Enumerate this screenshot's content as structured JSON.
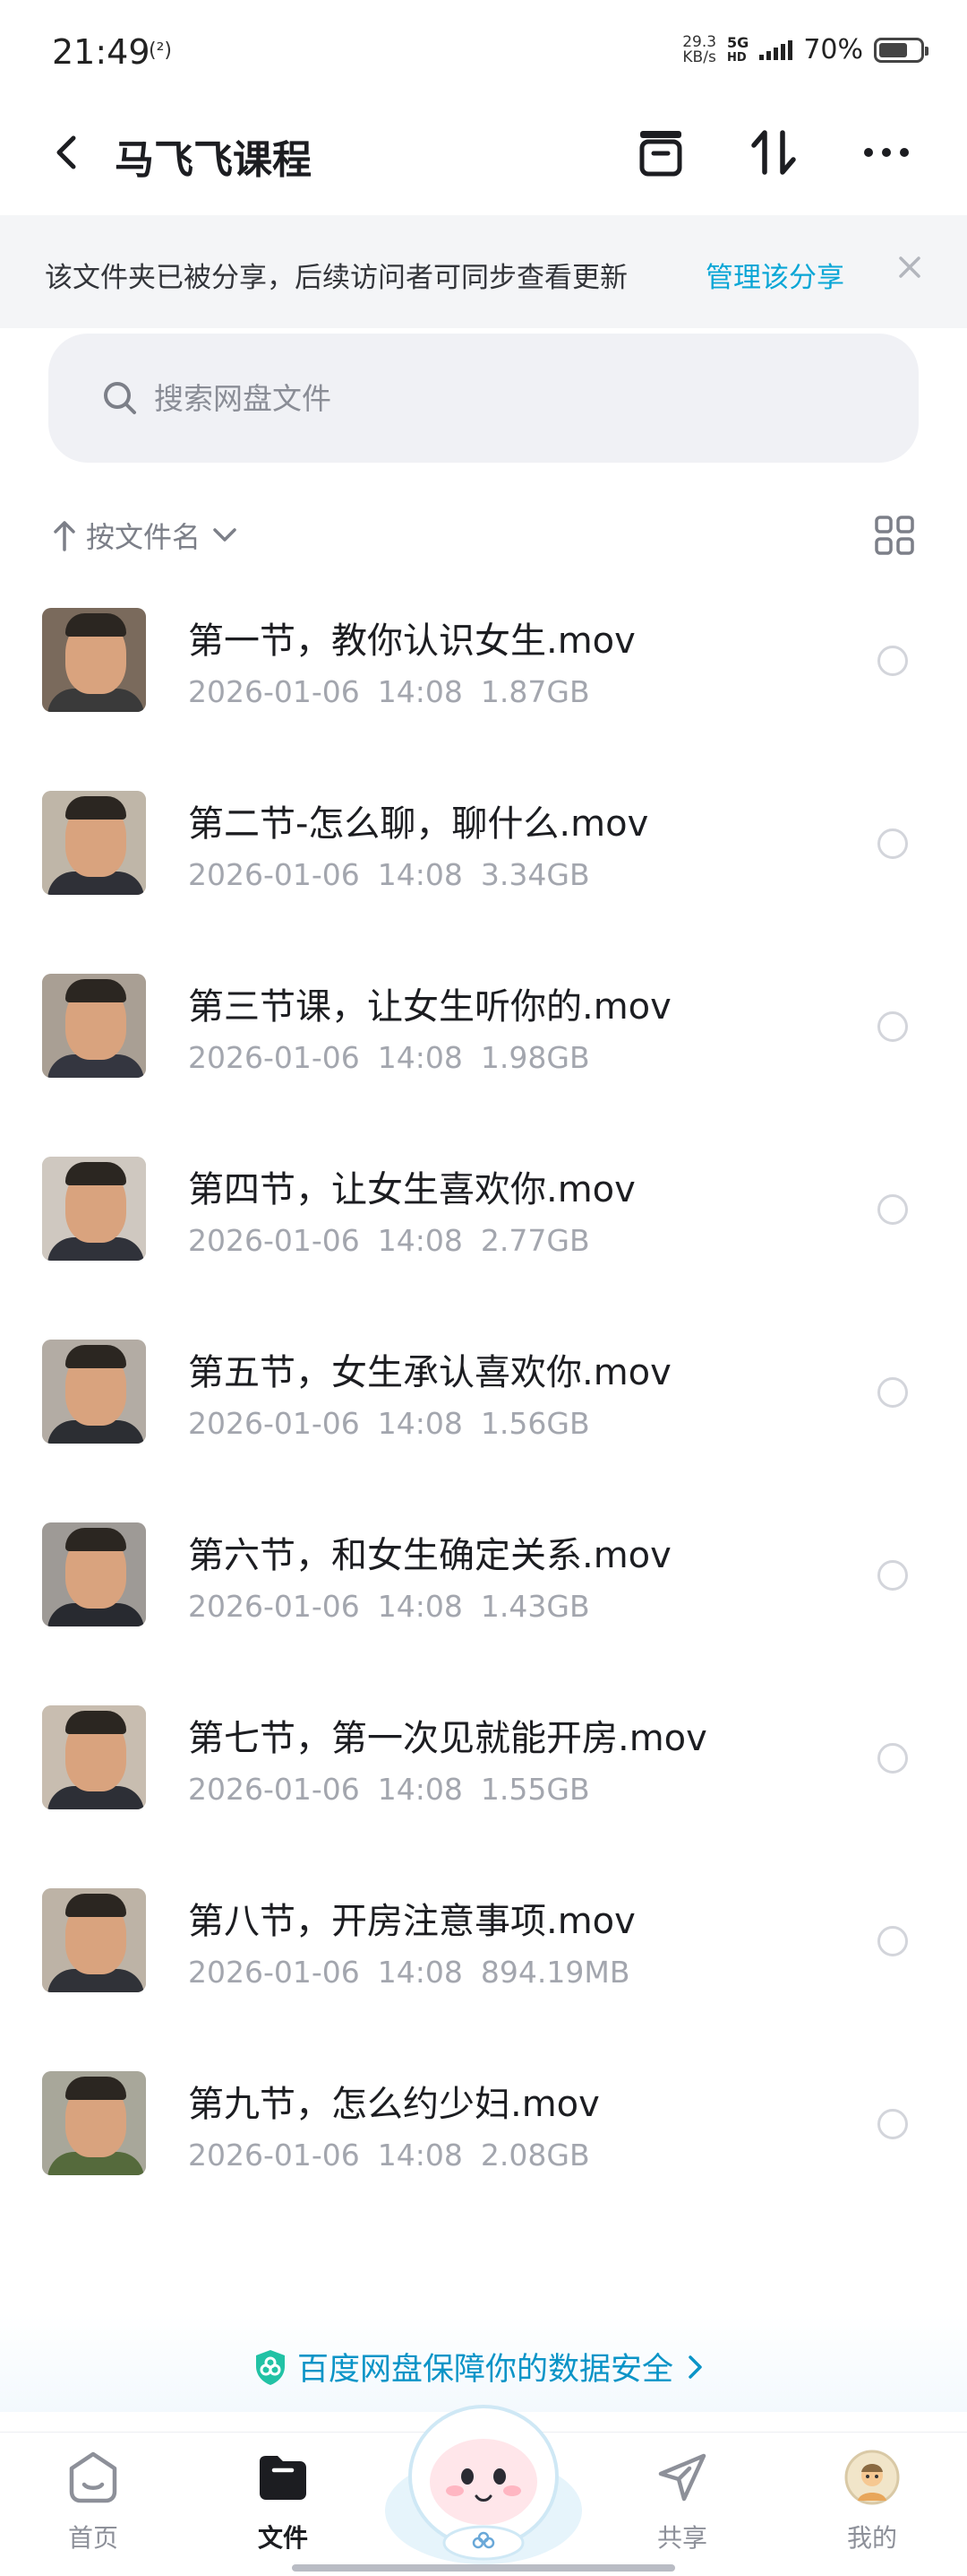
{
  "status_bar": {
    "time": "21:49",
    "signal_symbol": "(²)",
    "net_speed_value": "29.3",
    "net_speed_unit": "KB/s",
    "network_primary": "5G",
    "network_secondary": "HD",
    "battery_percent": "70%",
    "battery_level": 0.7
  },
  "header": {
    "title": "马飞飞课程",
    "icons": [
      "back-arrow-icon",
      "archive-box-icon",
      "sort-arrows-icon",
      "more-dots-icon"
    ]
  },
  "share_banner": {
    "message": "该文件夹已被分享，后续访问者可同步查看更新",
    "action": "管理该分享"
  },
  "search": {
    "placeholder": "搜索网盘文件"
  },
  "sort": {
    "label": "按文件名"
  },
  "files": [
    {
      "name": "第一节，教你认识女生.mov",
      "date": "2026-01-06",
      "time": "14:08",
      "size": "1.87GB"
    },
    {
      "name": "第二节-怎么聊，聊什么.mov",
      "date": "2026-01-06",
      "time": "14:08",
      "size": "3.34GB"
    },
    {
      "name": "第三节课，让女生听你的.mov",
      "date": "2026-01-06",
      "time": "14:08",
      "size": "1.98GB"
    },
    {
      "name": "第四节，让女生喜欢你.mov",
      "date": "2026-01-06",
      "time": "14:08",
      "size": "2.77GB"
    },
    {
      "name": "第五节，女生承认喜欢你.mov",
      "date": "2026-01-06",
      "time": "14:08",
      "size": "1.56GB"
    },
    {
      "name": "第六节，和女生确定关系.mov",
      "date": "2026-01-06",
      "time": "14:08",
      "size": "1.43GB"
    },
    {
      "name": "第七节，第一次见就能开房.mov",
      "date": "2026-01-06",
      "time": "14:08",
      "size": "1.55GB"
    },
    {
      "name": "第八节，开房注意事项.mov",
      "date": "2026-01-06",
      "time": "14:08",
      "size": "894.19MB"
    },
    {
      "name": "第九节，怎么约少妇.mov",
      "date": "2026-01-06",
      "time": "14:08",
      "size": "2.08GB"
    }
  ],
  "security": {
    "text": "百度网盘保障你的数据安全"
  },
  "bottom_nav": [
    {
      "label": "首页",
      "icon": "home-icon",
      "active": false
    },
    {
      "label": "文件",
      "icon": "folder-icon",
      "active": true
    },
    {
      "label": "共享",
      "icon": "send-icon",
      "active": false
    },
    {
      "label": "我的",
      "icon": "avatar-icon",
      "active": false
    }
  ],
  "colors": {
    "accent": "#0aa6d6",
    "security_text": "#0b94c7",
    "text_primary": "#1c1d21",
    "text_secondary": "#a3a6ae",
    "banner_bg": "#f4f5f7",
    "search_bg": "#f0f1f5"
  }
}
